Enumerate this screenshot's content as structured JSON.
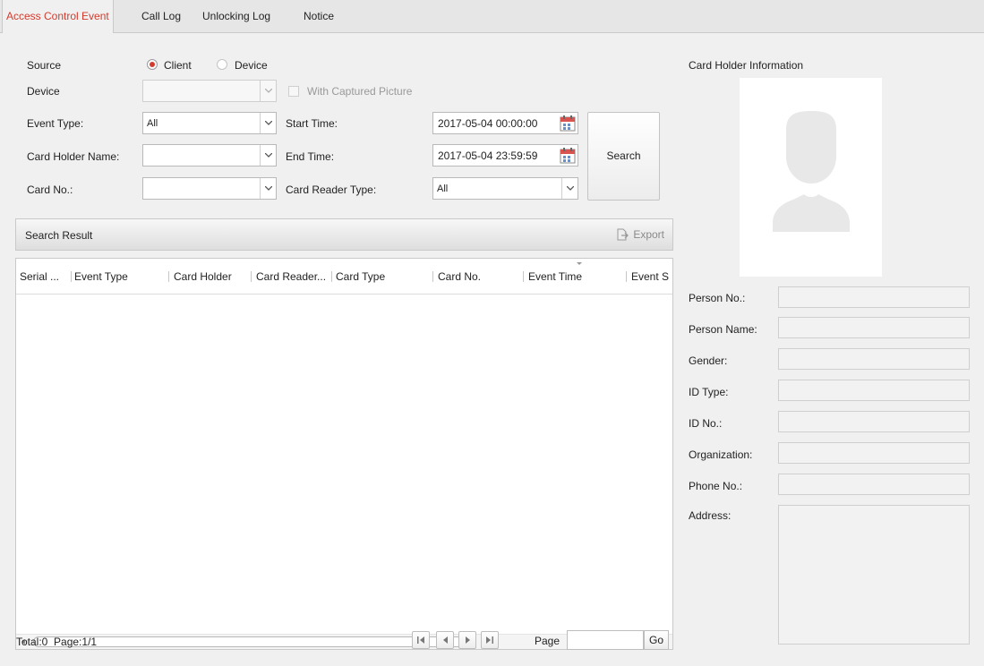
{
  "tabs": [
    "Access Control Event",
    "Call Log",
    "Unlocking Log",
    "Notice"
  ],
  "filters": {
    "source_label": "Source",
    "source_client": "Client",
    "source_device": "Device",
    "device_label": "Device",
    "device_value": "",
    "with_picture": "With Captured Picture",
    "event_type_label": "Event Type:",
    "event_type_value": "All",
    "card_holder_label": "Card Holder Name:",
    "card_holder_value": "",
    "card_no_label": "Card No.:",
    "card_no_value": "",
    "start_time_label": "Start Time:",
    "start_time_value": "2017-05-04 00:00:00",
    "end_time_label": "End Time:",
    "end_time_value": "2017-05-04 23:59:59",
    "reader_type_label": "Card Reader Type:",
    "reader_type_value": "All",
    "search_button": "Search"
  },
  "results": {
    "title": "Search Result",
    "export": "Export",
    "columns": [
      "Serial ...",
      "Event Type",
      "Card Holder",
      "Card Reader...",
      "Card Type",
      "Card No.",
      "Event Time",
      "Event S"
    ],
    "rows": [],
    "total": "Total:0",
    "page_info": "Page:1/1",
    "page_label": "Page",
    "page_value": "",
    "go": "Go"
  },
  "card_holder": {
    "title": "Card Holder Information",
    "fields": [
      {
        "label": "Person No.:",
        "value": ""
      },
      {
        "label": "Person Name:",
        "value": ""
      },
      {
        "label": "Gender:",
        "value": ""
      },
      {
        "label": "ID Type:",
        "value": ""
      },
      {
        "label": "ID No.:",
        "value": ""
      },
      {
        "label": "Organization:",
        "value": ""
      },
      {
        "label": "Phone No.:",
        "value": ""
      },
      {
        "label": "Address:",
        "value": ""
      }
    ]
  },
  "colors": {
    "accent": "#d23b2e",
    "panel": "#f0f0f0"
  }
}
